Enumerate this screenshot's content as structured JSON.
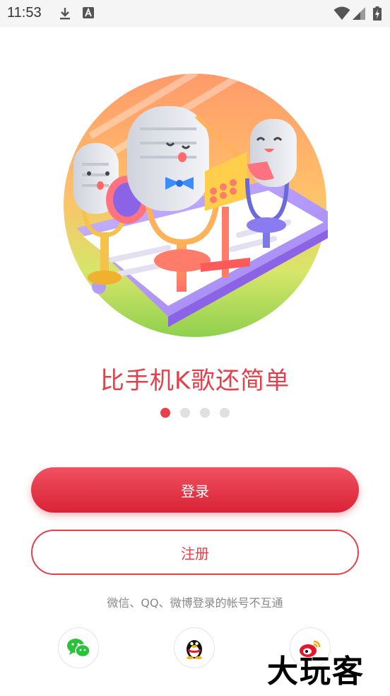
{
  "status_bar": {
    "time": "11:53",
    "icons": [
      "download-icon",
      "font-a-icon",
      "wifi-icon",
      "signal-icon",
      "battery-charging-icon"
    ]
  },
  "hero": {
    "illustration": "karaoke-microphones-illustration",
    "tagline": "比手机K歌还简单"
  },
  "pager": {
    "count": 4,
    "active_index": 0
  },
  "actions": {
    "login_label": "登录",
    "register_label": "注册"
  },
  "notice": "微信、QQ、微博登录的帐号不互通",
  "social_logins": [
    {
      "name": "wechat",
      "icon": "wechat-icon",
      "color": "#2bc13a"
    },
    {
      "name": "qq",
      "icon": "qq-penguin-icon",
      "color": "#111111"
    },
    {
      "name": "weibo",
      "icon": "weibo-icon",
      "color": "#e6162d"
    }
  ],
  "watermark": "大玩客",
  "colors": {
    "accent": "#e2404a",
    "accent_dark": "#da2236"
  }
}
